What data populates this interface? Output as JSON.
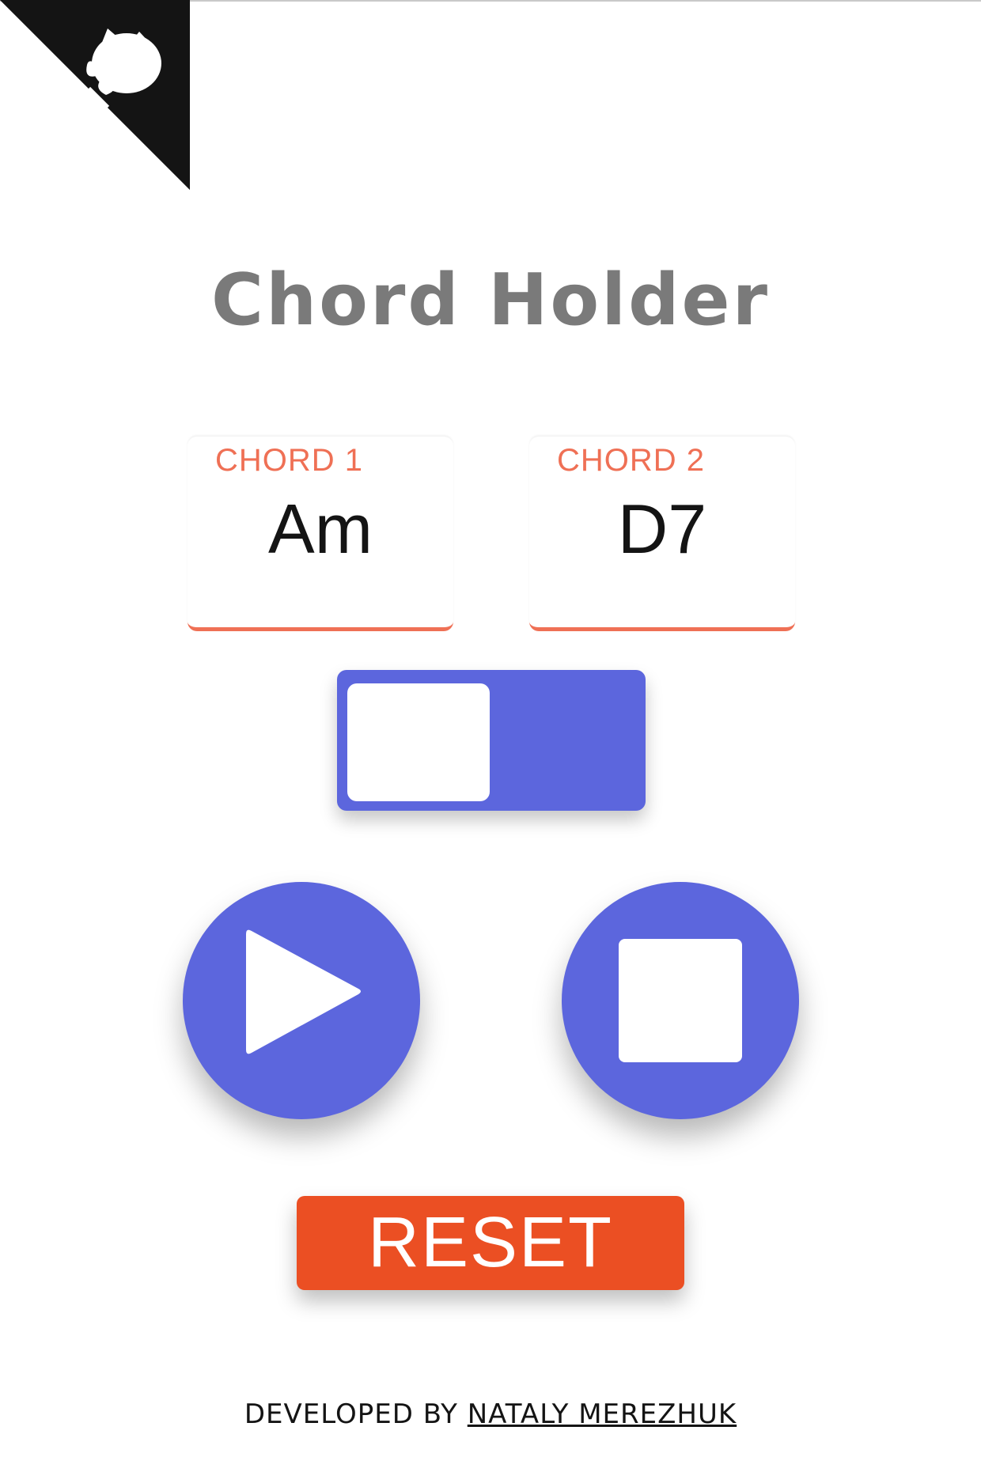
{
  "title": "Chord Holder",
  "chords": [
    {
      "label": "CHORD 1",
      "value": "Am"
    },
    {
      "label": "CHORD 2",
      "value": "D7"
    }
  ],
  "toggle": {
    "state": "off"
  },
  "controls": {
    "play_icon": "play-icon",
    "stop_icon": "stop-icon"
  },
  "reset_label": "RESET",
  "footer": {
    "prefix": "DEVELOPED BY ",
    "author": "NATALY MEREZHUK"
  },
  "colors": {
    "accent": "#5c66dd",
    "chord_label": "#ef7055",
    "reset": "#eb4f23",
    "title": "#7a7a7a",
    "corner": "#141414"
  }
}
